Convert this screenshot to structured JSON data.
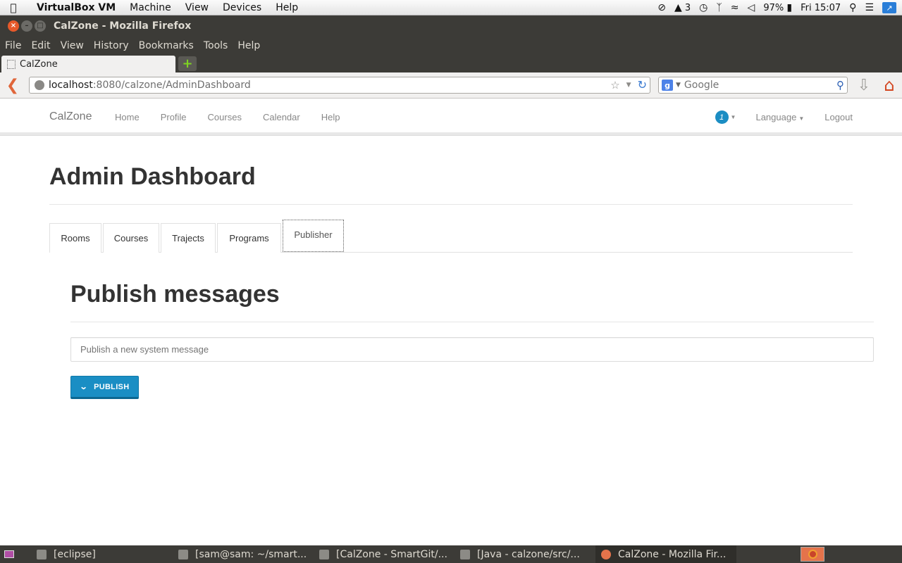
{
  "mac_menubar": {
    "app_name": "VirtualBox VM",
    "menus": [
      "Machine",
      "View",
      "Devices",
      "Help"
    ],
    "status": {
      "adobe_count": "3",
      "battery": "97%",
      "clock": "Fri 15:07"
    }
  },
  "window": {
    "title": "CalZone - Mozilla Firefox",
    "menus": [
      "File",
      "Edit",
      "View",
      "History",
      "Bookmarks",
      "Tools",
      "Help"
    ],
    "tab_label": "CalZone",
    "url_host": "localhost",
    "url_rest": ":8080/calzone/AdminDashboard",
    "search_placeholder": "Google"
  },
  "app": {
    "brand": "CalZone",
    "nav_links": [
      "Home",
      "Profile",
      "Courses",
      "Calendar",
      "Help"
    ],
    "notification_count": "1",
    "language_label": "Language",
    "logout_label": "Logout"
  },
  "page": {
    "title": "Admin Dashboard",
    "tabs": [
      "Rooms",
      "Courses",
      "Trajects",
      "Programs",
      "Publisher"
    ],
    "active_tab": "Publisher",
    "section_title": "Publish messages",
    "message_placeholder": "Publish a new system message",
    "publish_label": "PUBLISH"
  },
  "taskbar": {
    "tasks": [
      "[eclipse]",
      "[sam@sam: ~/smart...",
      "[CalZone - SmartGit/...",
      "[Java - calzone/src/...",
      "CalZone - Mozilla Fir..."
    ]
  },
  "colors": {
    "accent_blue": "#1a8ec4",
    "chrome_dark": "#3c3b37"
  }
}
